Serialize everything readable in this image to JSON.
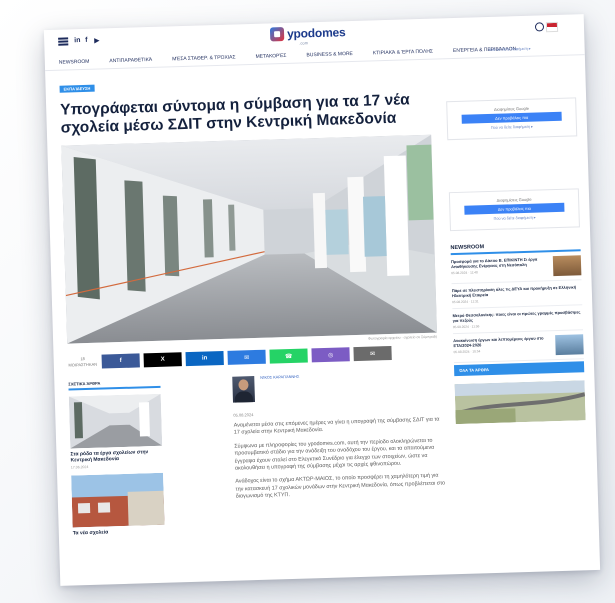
{
  "site": {
    "logo_text": "ypodomes",
    "logo_sub": ".com"
  },
  "header": {
    "social": [
      "in",
      "f",
      "▶"
    ],
    "nav": [
      "Newsroom",
      "Αντιπαραθετικά",
      "Μέσα σταθερ. & τρόχιας",
      "Μετακορές",
      "Business & more",
      "Κτιριακά & έργα πόλης",
      "Ενέργεια & Περιβάλλον"
    ]
  },
  "article": {
    "category": "Εκπαίδευση",
    "title": "Υπογράφεται σύντομα η σύμβαση για τα 17 νέα σχολεία μέσω ΣΔΙΤ στην Κεντρική Μακεδονία",
    "image_caption": "Φωτογραφία αρχείου · σχολείο σε Σύμπραξη",
    "share_count": "18",
    "share_count_label": "ΜΟΙΡΑΣΤΗΚΑΝ",
    "author": "Νίκος Καραγιάννης",
    "date": "05.08.2024",
    "paragraphs": [
      "Αναμένεται μέσα στις επόμενες ημέρες να γίνει η υπογραφή της σύμβασης ΣΔΙΤ για τα 17 σχολεία στην Κεντρική Μακεδονία.",
      "Σύμφωνα με πληροφορίες του ypodomes.com, αυτή την περίοδο ολοκληρώνεται το προσυμβατικό στάδιο για την ανάδειξη του αναδόχου του έργου, και τα απαιτούμενα έγγραφα έχουν σταλεί στο Ελεγκτικό Συνέδριο για έλεγχο των στοιχείων, ώστε να ακολουθήσει η υπογραφή της σύμβασης μέχρι τις αρχές φθινοπώρου.",
      "Ανάδοχος είναι το σχήμα ΑΚΤΩΡ-ΜΑΙΟΣ, το οποίο προσφέρει τη χαμηλότερη τιμή για την κατασκευή 17 σχολικών μονάδων στην Κεντρική Μακεδονία, όπως προβλέπεται στο διαγωνισμό της ΚΤΥΠ."
    ],
    "share_buttons": [
      {
        "label": "f",
        "color": "#3b5998",
        "name": "facebook-share-button"
      },
      {
        "label": "X",
        "color": "#000000",
        "name": "x-share-button"
      },
      {
        "label": "in",
        "color": "#0a66c2",
        "name": "linkedin-share-button"
      },
      {
        "label": "✉",
        "color": "#2d7be0",
        "name": "messenger-share-button"
      },
      {
        "label": "☎",
        "color": "#25d366",
        "name": "whatsapp-share-button"
      },
      {
        "label": "◎",
        "color": "#7c5cc4",
        "name": "viber-share-button"
      },
      {
        "label": "✉",
        "color": "#6b6b6b",
        "name": "email-share-button"
      }
    ]
  },
  "sidebar_left": {
    "title": "Σχετικά άρθρα",
    "items": [
      {
        "text": "Στα ρόδα τα έργα σχολείων στην Κεντρική Μακεδονία",
        "date": "17.06.2024"
      },
      {
        "text": "Τα νέα σχολεία",
        "date": ""
      }
    ]
  },
  "right": {
    "ad_link_top": "Πού να δείτε διαφήμιση ▸",
    "ads": [
      {
        "label": "Διαφημίσεις Google",
        "button": "Δεν προβάλεις πια",
        "link": "Πού να δείτε διαφήμιση ▸"
      },
      {
        "label": "Διαφημίσεις Google",
        "button": "Δεν προβάλεις πια",
        "link": "Πού να δείτε διαφήμιση ▸"
      }
    ],
    "newsroom_title": "NEWSROOM",
    "newsroom": [
      {
        "headline": "Προσφορά για το Δίκτυο Β. ΕΠΙΚΙΝΤΗ Σι έργα Αποθήκευσης Ενέργειας στη Νεσόπολη",
        "date": "05.08.2024 · 11:48"
      },
      {
        "headline": "Πάρε σε πλειστηρίαση όλες τις ΔΕΥΑ και προκήρυξη σε Ελληνική Ηλεκτρική Εταιρεία",
        "date": "05.08.2024 · 11:31"
      },
      {
        "headline": "Μετρό Θεσσαλονίκης: ποιες είναι οι πρώτες γραμμές προσβάσιμες για πεζούς",
        "date": "05.08.2024 · 11:06"
      },
      {
        "headline": "Ανακοίνωση έργων και λεπτομέρειες έργου στο ΕΤΑ/2024-2026",
        "date": "05.08.2024 · 10:54"
      }
    ],
    "newsroom_more": "Όλα τα άρθρα"
  }
}
